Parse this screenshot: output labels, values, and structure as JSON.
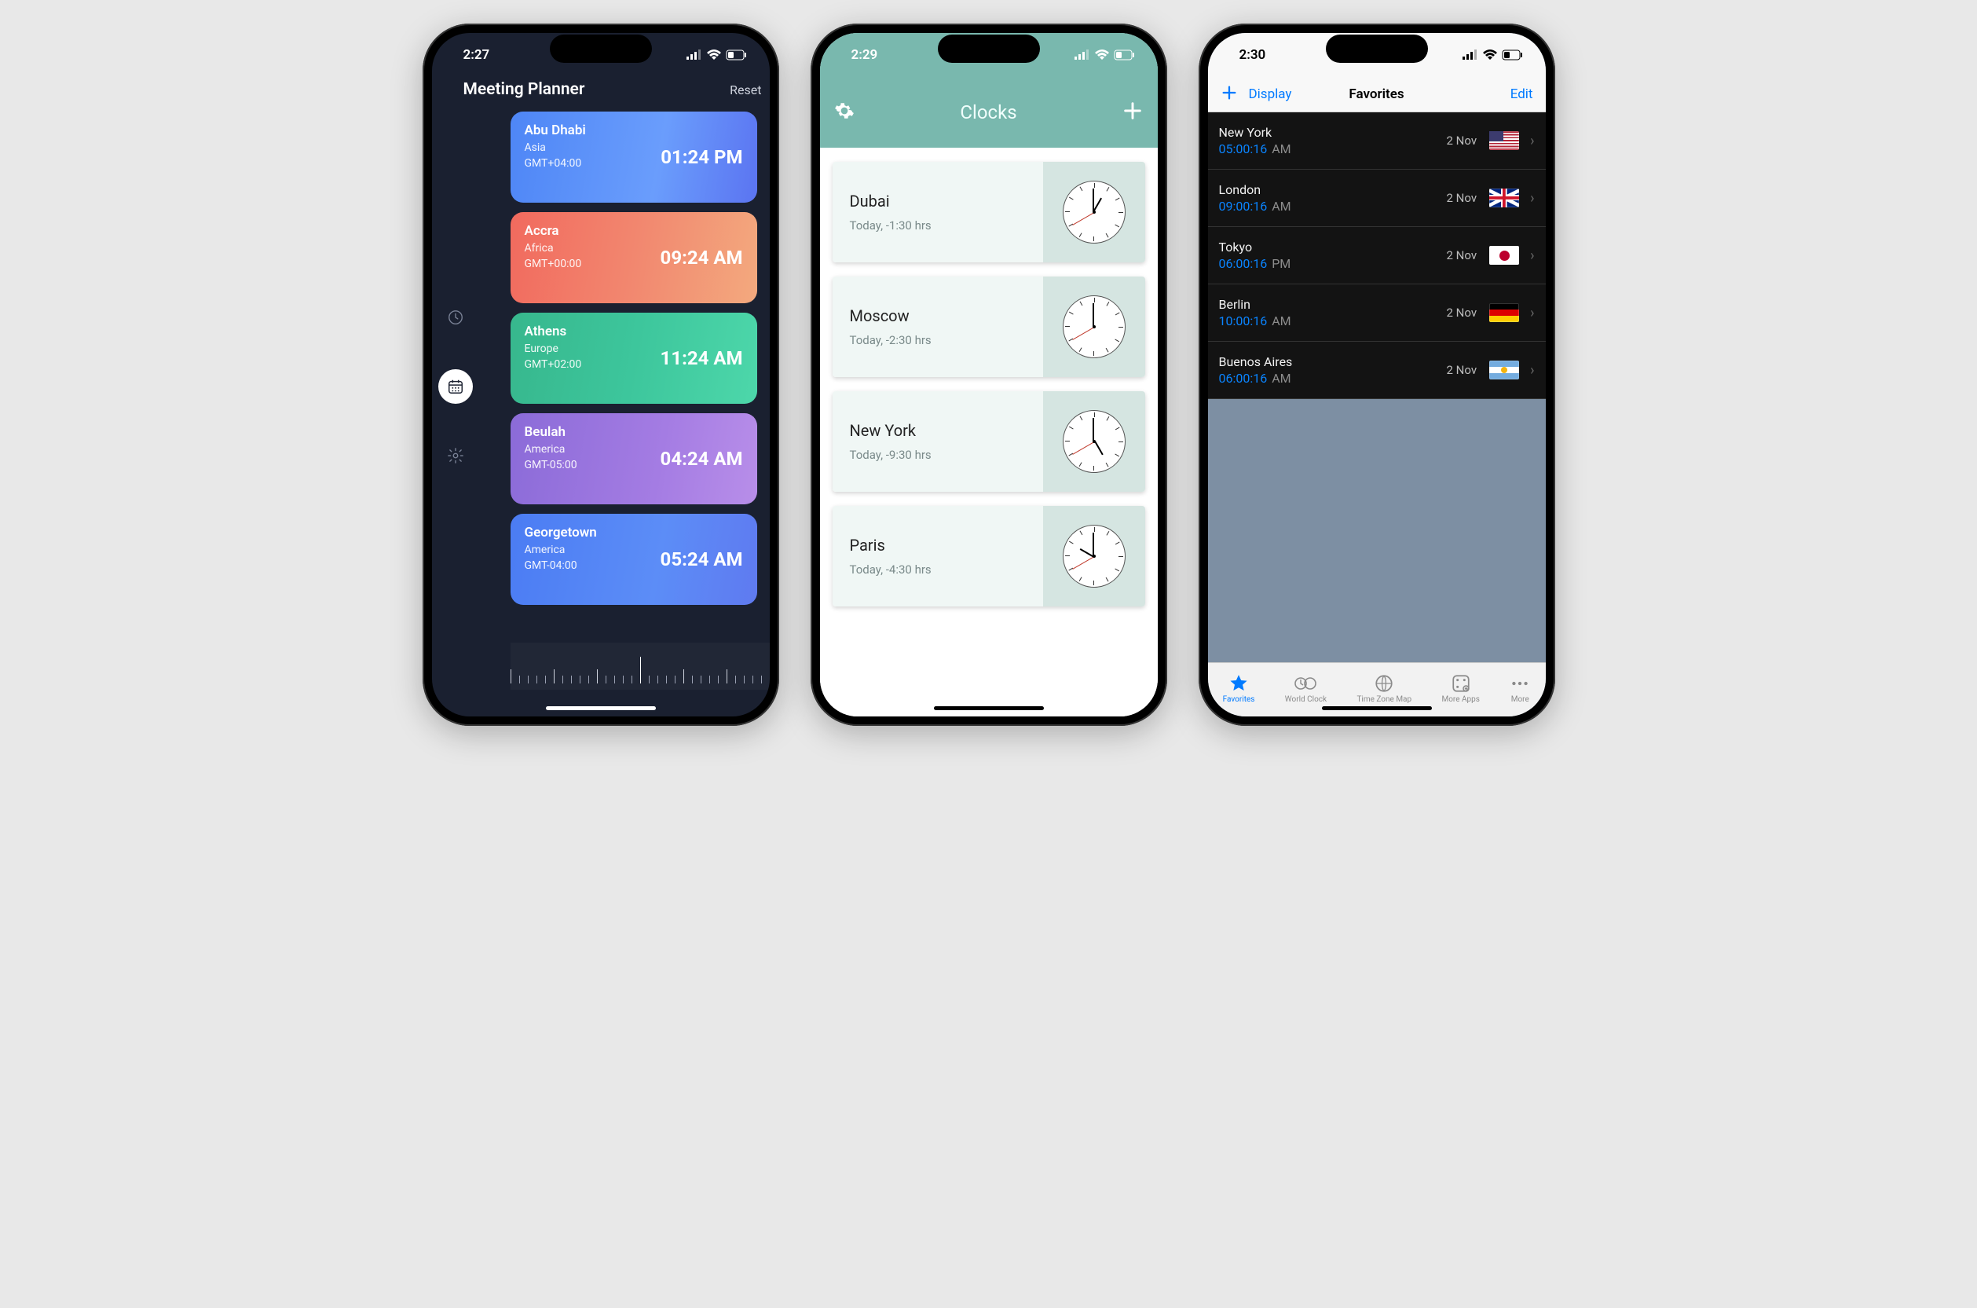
{
  "phone1": {
    "status_time": "2:27",
    "header_title": "Meeting Planner",
    "reset_label": "Reset",
    "cards": [
      {
        "city": "Abu Dhabi",
        "continent": "Asia",
        "gmt": "GMT+04:00",
        "time": "01:24 PM",
        "grad": "linear-gradient(100deg,#4e86f6 0%,#6a9dfc 60%,#5b74f1 100%)"
      },
      {
        "city": "Accra",
        "continent": "Africa",
        "gmt": "GMT+00:00",
        "time": "09:24 AM",
        "grad": "linear-gradient(100deg,#f16a5e 0%,#f2876f 50%,#f3a97e 100%)"
      },
      {
        "city": "Athens",
        "continent": "Europe",
        "gmt": "GMT+02:00",
        "time": "11:24 AM",
        "grad": "linear-gradient(100deg,#37b78d 0%,#3dc69c 50%,#4dd7aa 100%)"
      },
      {
        "city": "Beulah",
        "continent": "America",
        "gmt": "GMT-05:00",
        "time": "04:24 AM",
        "grad": "linear-gradient(100deg,#8b6bd8 0%,#a47ce3 60%,#b88ee9 100%)"
      },
      {
        "city": "Georgetown",
        "continent": "America",
        "gmt": "GMT-04:00",
        "time": "05:24 AM",
        "grad": "linear-gradient(100deg,#4b7cf3 0%,#5c8df7 60%,#5f7af0 100%)"
      }
    ]
  },
  "phone2": {
    "status_time": "2:29",
    "nav_title": "Clocks",
    "rows": [
      {
        "city": "Dubai",
        "sub": "Today, -1:30 hrs",
        "hour": 1,
        "min": 0,
        "sec": 40
      },
      {
        "city": "Moscow",
        "sub": "Today, -2:30 hrs",
        "hour": 12,
        "min": 0,
        "sec": 40
      },
      {
        "city": "New York",
        "sub": "Today, -9:30 hrs",
        "hour": 5,
        "min": 0,
        "sec": 40
      },
      {
        "city": "Paris",
        "sub": "Today, -4:30 hrs",
        "hour": 10,
        "min": 0,
        "sec": 40
      }
    ]
  },
  "phone3": {
    "status_time": "2:30",
    "nav_display": "Display",
    "nav_title": "Favorites",
    "nav_edit": "Edit",
    "rows": [
      {
        "city": "New York",
        "time": "05:00:16",
        "ampm": "AM",
        "date": "2 Nov",
        "flag": "flag-us"
      },
      {
        "city": "London",
        "time": "09:00:16",
        "ampm": "AM",
        "date": "2 Nov",
        "flag": "flag-uk"
      },
      {
        "city": "Tokyo",
        "time": "06:00:16",
        "ampm": "PM",
        "date": "2 Nov",
        "flag": "flag-jp"
      },
      {
        "city": "Berlin",
        "time": "10:00:16",
        "ampm": "AM",
        "date": "2 Nov",
        "flag": "flag-de"
      },
      {
        "city": "Buenos Aires",
        "time": "06:00:16",
        "ampm": "AM",
        "date": "2 Nov",
        "flag": "flag-ar"
      }
    ],
    "tabs": [
      {
        "label": "Favorites",
        "active": true
      },
      {
        "label": "World Clock",
        "active": false
      },
      {
        "label": "Time Zone Map",
        "active": false
      },
      {
        "label": "More Apps",
        "active": false
      },
      {
        "label": "More",
        "active": false
      }
    ]
  }
}
